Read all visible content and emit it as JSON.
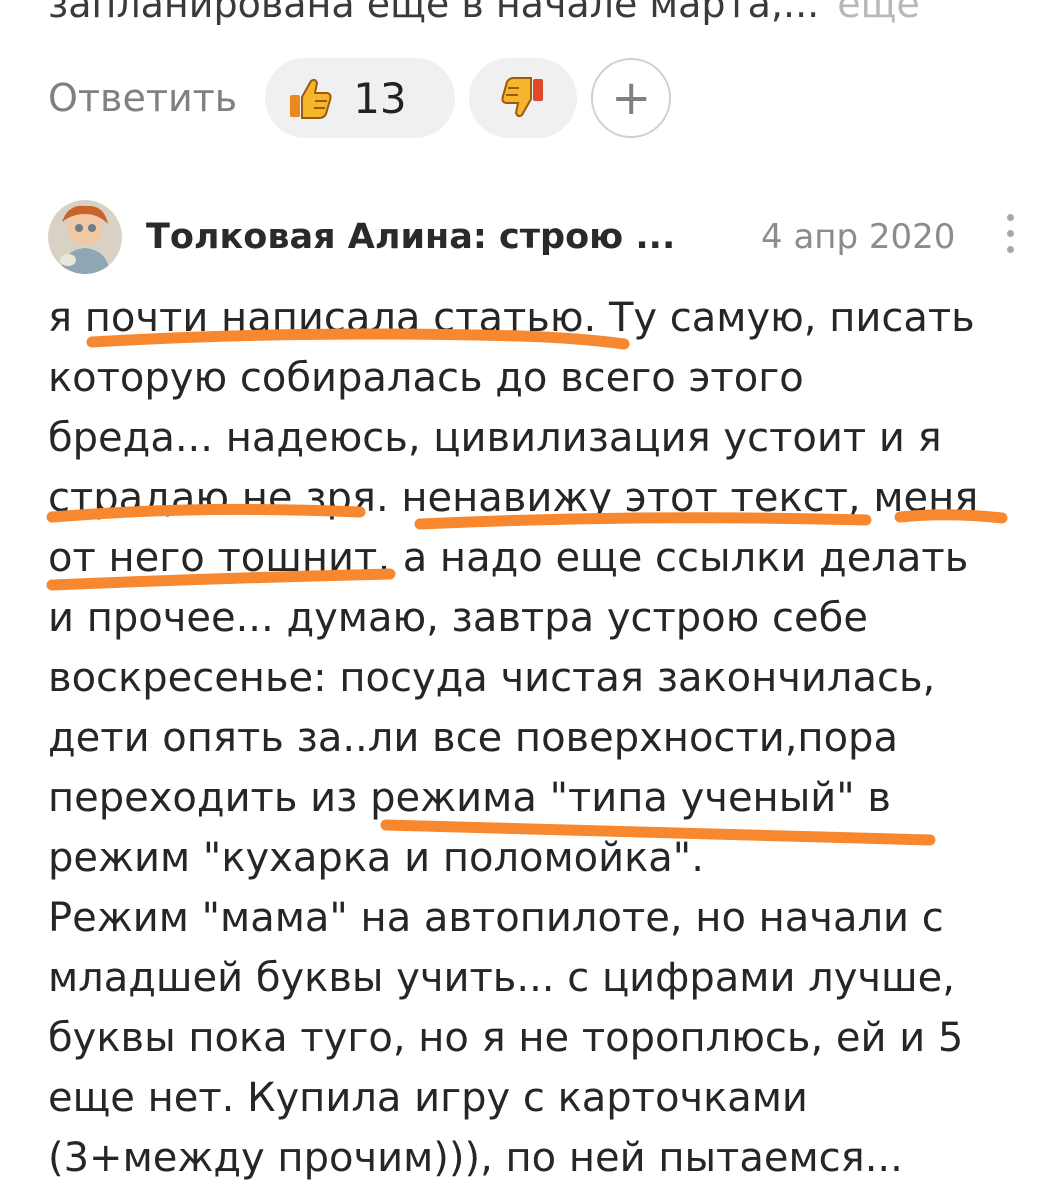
{
  "previous_comment": {
    "text_fragment": "запланирована еще в начале марта,...",
    "more_label": "еще"
  },
  "actions": {
    "reply_label": "Ответить",
    "like_count": "13",
    "like_icon": "thumbs-up-icon",
    "dislike_icon": "thumbs-down-icon",
    "add_reaction_label": "+"
  },
  "comment": {
    "author": "Толковая Алина: строю ...",
    "date": "4 апр 2020",
    "menu_icon": "more-vertical-icon",
    "lines": [
      "я почти написала статью. Ту самую, писать",
      "которую собиралась до всего этого",
      "бреда... надеюсь, цивилизация устоит и я",
      "страдаю не зря. ненавижу этот текст, меня",
      "от него тошнит, а надо еще ссылки делать",
      "и прочее... думаю, завтра устрою себе",
      "воскресенье: посуда чистая закончилась,",
      "дети опять за..ли все поверхности,пора",
      "переходить из режима \"типа ученый\" в",
      "режим \"кухарка и поломойка\".",
      "Режим \"мама\" на автопилоте, но начали с",
      "младшей буквы учить... с цифрами лучше,",
      "буквы пока туго, но я не тороплюсь, ей и 5",
      "еще нет. Купила игру с карточками",
      "(3+между прочим))), по ней пытаемся..."
    ]
  },
  "colors": {
    "highlight_stroke": "#f7882f",
    "pill_bg": "#f0f0f0",
    "muted_text": "#8c8c8c"
  }
}
